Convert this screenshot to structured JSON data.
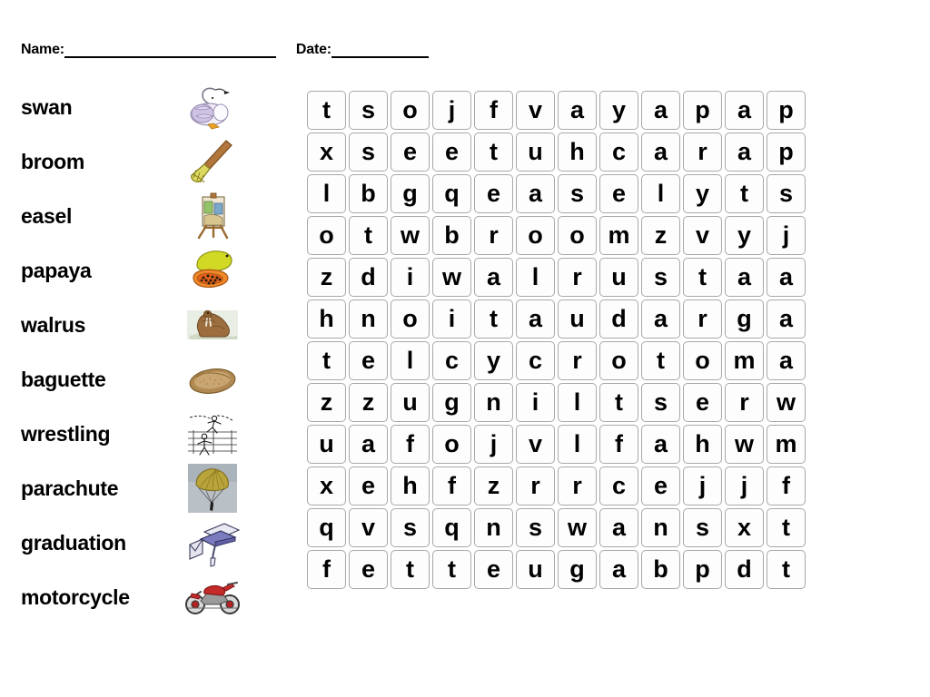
{
  "worksheet": {
    "name_label": "Name:",
    "date_label": "Date:"
  },
  "word_list": [
    {
      "word": "swan",
      "icon": "swan-illustration"
    },
    {
      "word": "broom",
      "icon": "broom-illustration"
    },
    {
      "word": "easel",
      "icon": "easel-illustration"
    },
    {
      "word": "papaya",
      "icon": "papaya-illustration"
    },
    {
      "word": "walrus",
      "icon": "walrus-illustration"
    },
    {
      "word": "baguette",
      "icon": "baguette-illustration"
    },
    {
      "word": "wrestling",
      "icon": "wrestling-illustration"
    },
    {
      "word": "parachute",
      "icon": "parachute-illustration"
    },
    {
      "word": "graduation",
      "icon": "graduation-illustration"
    },
    {
      "word": "motorcycle",
      "icon": "motorcycle-illustration"
    }
  ],
  "grid": {
    "rows": 12,
    "columns": 12,
    "letters": [
      [
        "t",
        "s",
        "o",
        "j",
        "f",
        "v",
        "a",
        "y",
        "a",
        "p",
        "a",
        "p"
      ],
      [
        "x",
        "s",
        "e",
        "e",
        "t",
        "u",
        "h",
        "c",
        "a",
        "r",
        "a",
        "p"
      ],
      [
        "l",
        "b",
        "g",
        "q",
        "e",
        "a",
        "s",
        "e",
        "l",
        "y",
        "t",
        "s"
      ],
      [
        "o",
        "t",
        "w",
        "b",
        "r",
        "o",
        "o",
        "m",
        "z",
        "v",
        "y",
        "j"
      ],
      [
        "z",
        "d",
        "i",
        "w",
        "a",
        "l",
        "r",
        "u",
        "s",
        "t",
        "a",
        "a"
      ],
      [
        "h",
        "n",
        "o",
        "i",
        "t",
        "a",
        "u",
        "d",
        "a",
        "r",
        "g",
        "a"
      ],
      [
        "t",
        "e",
        "l",
        "c",
        "y",
        "c",
        "r",
        "o",
        "t",
        "o",
        "m",
        "a"
      ],
      [
        "z",
        "z",
        "u",
        "g",
        "n",
        "i",
        "l",
        "t",
        "s",
        "e",
        "r",
        "w"
      ],
      [
        "u",
        "a",
        "f",
        "o",
        "j",
        "v",
        "l",
        "f",
        "a",
        "h",
        "w",
        "m"
      ],
      [
        "x",
        "e",
        "h",
        "f",
        "z",
        "r",
        "r",
        "c",
        "e",
        "j",
        "j",
        "f"
      ],
      [
        "q",
        "v",
        "s",
        "q",
        "n",
        "s",
        "w",
        "a",
        "n",
        "s",
        "x",
        "t"
      ],
      [
        "f",
        "e",
        "t",
        "t",
        "e",
        "u",
        "g",
        "a",
        "b",
        "p",
        "d",
        "t"
      ]
    ]
  },
  "colors": {
    "cell_border": "#a8a8a8",
    "cell_fill": "#fdfdfd",
    "text": "#000000",
    "page_background": "#ffffff"
  }
}
